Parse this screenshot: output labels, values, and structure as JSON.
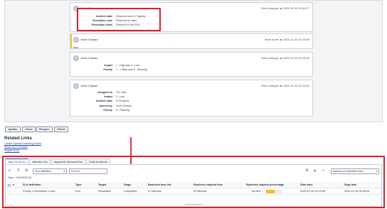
{
  "activity": {
    "items": [
      {
        "author": "Vivek Chavan",
        "header": "Field changes",
        "timestamp": "2025-12-30 02:46:27",
        "fields": [
          {
            "k": "Incident state",
            "v": "Resolved was In Progress"
          },
          {
            "k": "Resolution code",
            "v": "Resolved by caller"
          },
          {
            "k": "Resolution notes",
            "v": "Resolved to test SLA"
          }
        ]
      },
      {
        "author": "Vivek Chavan",
        "header": "Work notes",
        "timestamp": "2025-12-30 02:15:59",
        "note": "test"
      },
      {
        "author": "Vivek Chavan",
        "header": "Field changes",
        "timestamp": "2025-12-30 02:15:59",
        "fields": [
          {
            "k": "Impact",
            "v": "1 - High was 3 - Low"
          },
          {
            "k": "Priority",
            "v": "1 - Critical was 5 - Planning"
          }
        ]
      },
      {
        "author": "Vivek Chavan",
        "header": "Field changes",
        "timestamp": "2025-12-30 02:13:41",
        "fields": [
          {
            "k": "Assigned to",
            "v": "ITIL User"
          },
          {
            "k": "Impact",
            "v": "3 - Low"
          },
          {
            "k": "Incident state",
            "v": "In Progress"
          },
          {
            "k": "Opened by",
            "v": "Vivek Chavan"
          },
          {
            "k": "Priority",
            "v": "5 - Planning"
          }
        ]
      }
    ]
  },
  "buttons": {
    "update": "Update",
    "close": "Close",
    "reopen": "Reopen",
    "delete": "Delete"
  },
  "related_links": {
    "title": "Related Links",
    "links": [
      "Create Special Handling Notes",
      "Show SLA Timeline",
      "Repair SLAs"
    ]
  },
  "tabs": [
    "Task SLAs (1)",
    "Affected CIs",
    "Impacted Services/CIs",
    "Child Incidents"
  ],
  "toolbar": {
    "field_select": "SLA definition",
    "search_placeholder": "Search",
    "actions_select": "Actions on selected rows..."
  },
  "breadcrumb": "Task = INC0010113",
  "table": {
    "headers": [
      "SLA definition",
      "Type",
      "Target",
      "Stage",
      "Business time left",
      "Business elapsed time",
      "Business elapsed percentage",
      "Start time",
      "Stop time"
    ],
    "rows": [
      [
        "Priority 1 Resolution 1 hour",
        "SLA",
        "Resolution",
        "Completed",
        "27 Minutes",
        "32 Minutes",
        "54.08%",
        "2025-12-30 02:13:59",
        "2025-12-30 02:46:26"
      ]
    ],
    "elapsed_fraction": 0.5408
  },
  "colors": {
    "highlight": "#e11d2b",
    "progress": "#f6bb1f",
    "link": "#1f4aa5"
  }
}
